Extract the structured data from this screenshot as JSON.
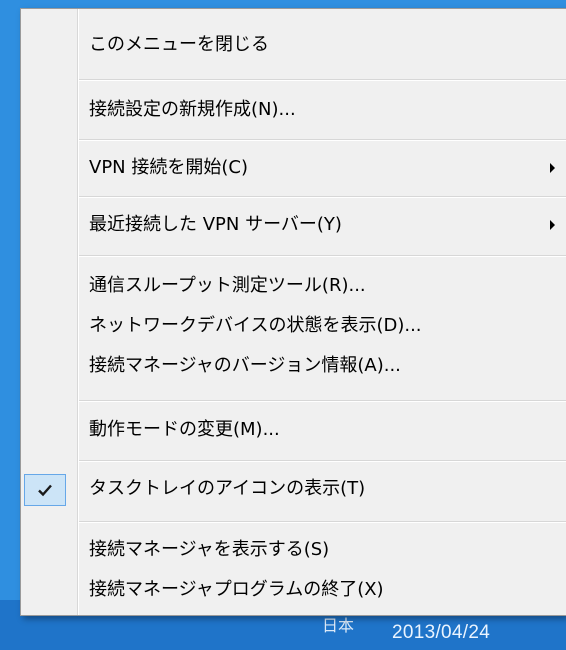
{
  "menu": {
    "items": [
      {
        "label": "このメニューを閉じる"
      },
      {
        "label": "接続設定の新規作成(N)..."
      },
      {
        "label": "VPN 接続を開始(C)"
      },
      {
        "label": "最近接続した VPN サーバー(Y)"
      },
      {
        "label": "通信スループット測定ツール(R)..."
      },
      {
        "label": "ネットワークデバイスの状態を表示(D)..."
      },
      {
        "label": "接続マネージャのバージョン情報(A)..."
      },
      {
        "label": "動作モードの変更(M)..."
      },
      {
        "label": "タスクトレイのアイコンの表示(T)"
      },
      {
        "label": "接続マネージャを表示する(S)"
      },
      {
        "label": "接続マネージャプログラムの終了(X)"
      }
    ]
  },
  "taskbar": {
    "date": "2013/04/24",
    "partial_text": "日本"
  }
}
